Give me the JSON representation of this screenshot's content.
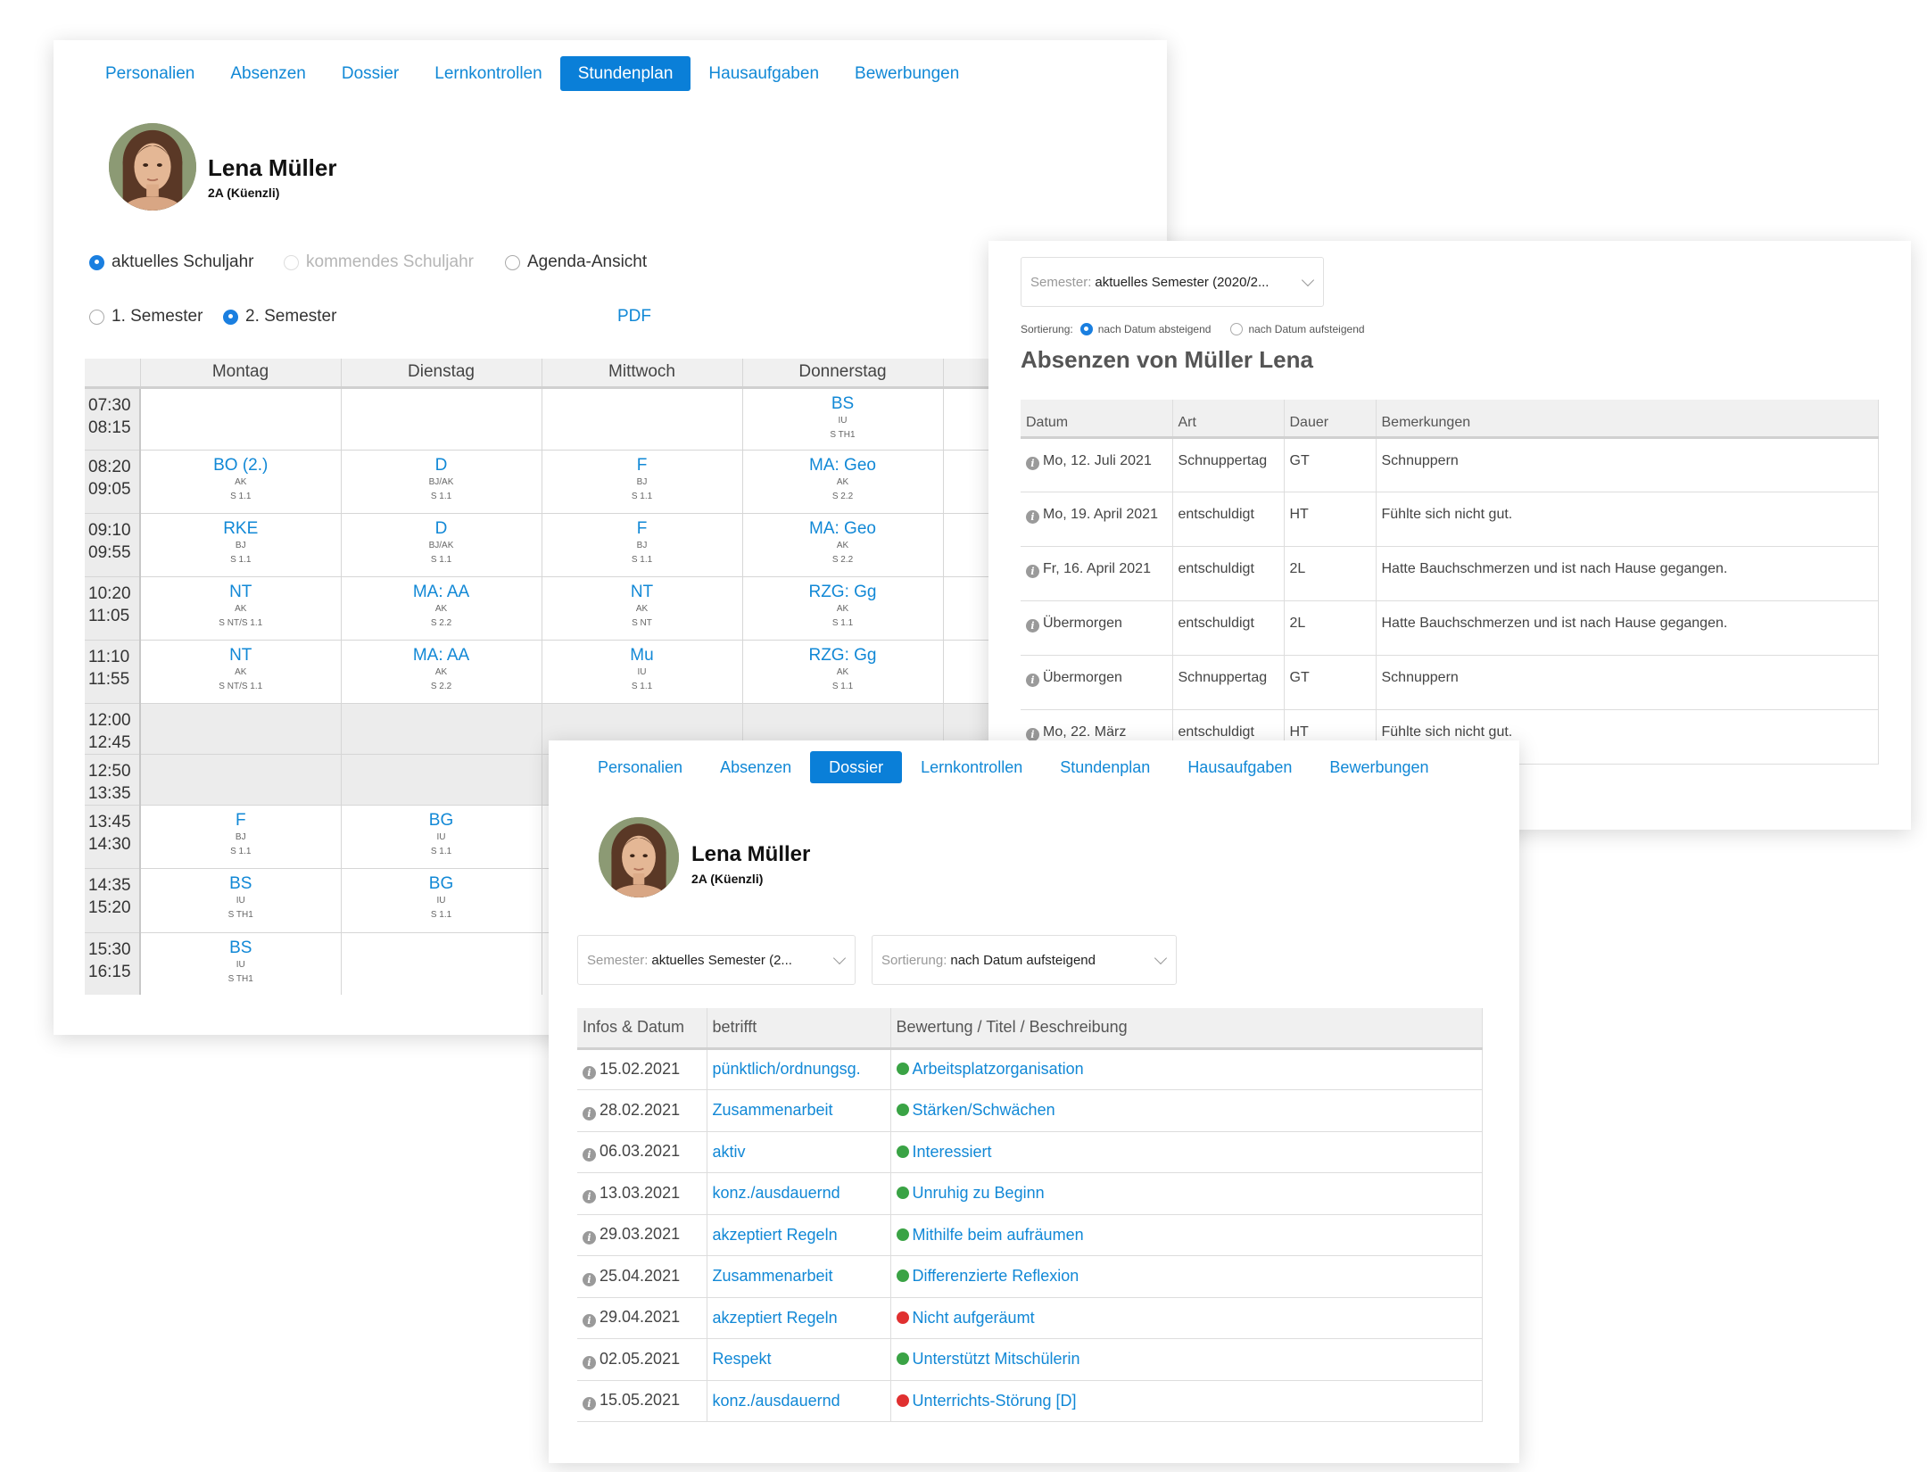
{
  "tabs": [
    "Personalien",
    "Absenzen",
    "Dossier",
    "Lernkontrollen",
    "Stundenplan",
    "Hausaufgaben",
    "Bewerbungen"
  ],
  "student": {
    "name": "Lena Müller",
    "class": "2A (Küenzli)"
  },
  "timetable_panel": {
    "active_tab": "Stundenplan",
    "view_options": [
      "aktuelles Schuljahr",
      "kommendes Schuljahr",
      "Agenda-Ansicht"
    ],
    "semester_options": [
      "1. Semester",
      "2. Semester"
    ],
    "pdf_label": "PDF",
    "days": [
      "Montag",
      "Dienstag",
      "Mittwoch",
      "Donnerstag"
    ],
    "slots": [
      {
        "start": "07:30",
        "end": "08:15",
        "cells": [
          null,
          null,
          null,
          {
            "s": "BS",
            "t": "IU",
            "r": "S TH1"
          }
        ]
      },
      {
        "start": "08:20",
        "end": "09:05",
        "cells": [
          {
            "s": "BO (2.)",
            "t": "AK",
            "r": "S 1.1"
          },
          {
            "s": "D",
            "t": "BJ/AK",
            "r": "S 1.1"
          },
          {
            "s": "F",
            "t": "BJ",
            "r": "S 1.1"
          },
          {
            "s": "MA: Geo",
            "t": "AK",
            "r": "S 2.2"
          }
        ]
      },
      {
        "start": "09:10",
        "end": "09:55",
        "cells": [
          {
            "s": "RKE",
            "t": "BJ",
            "r": "S 1.1"
          },
          {
            "s": "D",
            "t": "BJ/AK",
            "r": "S 1.1"
          },
          {
            "s": "F",
            "t": "BJ",
            "r": "S 1.1"
          },
          {
            "s": "MA: Geo",
            "t": "AK",
            "r": "S 2.2"
          }
        ]
      },
      {
        "start": "10:20",
        "end": "11:05",
        "cells": [
          {
            "s": "NT",
            "t": "AK",
            "r": "S NT/S 1.1"
          },
          {
            "s": "MA: AA",
            "t": "AK",
            "r": "S 2.2"
          },
          {
            "s": "NT",
            "t": "AK",
            "r": "S NT"
          },
          {
            "s": "RZG: Gg",
            "t": "AK",
            "r": "S 1.1"
          }
        ]
      },
      {
        "start": "11:10",
        "end": "11:55",
        "cells": [
          {
            "s": "NT",
            "t": "AK",
            "r": "S NT/S 1.1"
          },
          {
            "s": "MA: AA",
            "t": "AK",
            "r": "S 2.2"
          },
          {
            "s": "Mu",
            "t": "IU",
            "r": "S 1.1"
          },
          {
            "s": "RZG: Gg",
            "t": "AK",
            "r": "S 1.1"
          }
        ]
      },
      {
        "start": "12:00",
        "end": "12:45",
        "brk": true,
        "cells": [
          null,
          null,
          null,
          null
        ]
      },
      {
        "start": "12:50",
        "end": "13:35",
        "brk": true,
        "cells": [
          null,
          null,
          null,
          null
        ]
      },
      {
        "start": "13:45",
        "end": "14:30",
        "cells": [
          {
            "s": "F",
            "t": "BJ",
            "r": "S 1.1"
          },
          {
            "s": "BG",
            "t": "IU",
            "r": "S 1.1"
          },
          null,
          null
        ]
      },
      {
        "start": "14:35",
        "end": "15:20",
        "cells": [
          {
            "s": "BS",
            "t": "IU",
            "r": "S TH1"
          },
          {
            "s": "BG",
            "t": "IU",
            "r": "S 1.1"
          },
          null,
          null
        ]
      },
      {
        "start": "15:30",
        "end": "16:15",
        "cells": [
          {
            "s": "BS",
            "t": "IU",
            "r": "S TH1"
          },
          null,
          null,
          null
        ]
      }
    ]
  },
  "absences_panel": {
    "semester_label": "Semester:",
    "semester_value": "aktuelles Semester (2020/2...",
    "sort_label": "Sortierung:",
    "sort_options": [
      "nach Datum absteigend",
      "nach Datum aufsteigend"
    ],
    "title": "Absenzen von Müller Lena",
    "headers": [
      "Datum",
      "Art",
      "Dauer",
      "Bemerkungen"
    ],
    "rows": [
      [
        "Mo, 12. Juli 2021",
        "Schnuppertag",
        "GT",
        "Schnuppern"
      ],
      [
        "Mo, 19. April 2021",
        "entschuldigt",
        "HT",
        "Fühlte sich nicht gut."
      ],
      [
        "Fr, 16. April 2021",
        "entschuldigt",
        "2L",
        "Hatte Bauchschmerzen und ist nach Hause gegangen."
      ],
      [
        "Übermorgen",
        "entschuldigt",
        "2L",
        "Hatte Bauchschmerzen und ist nach Hause gegangen."
      ],
      [
        "Übermorgen",
        "Schnuppertag",
        "GT",
        "Schnuppern"
      ],
      [
        "Mo, 22. März",
        "entschuldigt",
        "HT",
        "Fühlte sich nicht gut."
      ]
    ]
  },
  "dossier_panel": {
    "active_tab": "Dossier",
    "semester_label": "Semester:",
    "semester_value": "aktuelles Semester (2...",
    "sort_label": "Sortierung:",
    "sort_value": "nach Datum aufsteigend",
    "headers": [
      "Infos & Datum",
      "betrifft",
      "Bewertung / Titel / Beschreibung"
    ],
    "rows": [
      {
        "date": "15.02.2021",
        "topic": "pünktlich/ordnungsg.",
        "rating": "good",
        "text": "Arbeitsplatzorganisation"
      },
      {
        "date": "28.02.2021",
        "topic": "Zusammenarbeit",
        "rating": "good",
        "text": "Stärken/Schwächen"
      },
      {
        "date": "06.03.2021",
        "topic": "aktiv",
        "rating": "good",
        "text": "Interessiert"
      },
      {
        "date": "13.03.2021",
        "topic": "konz./ausdauernd",
        "rating": "good",
        "text": "Unruhig zu Beginn"
      },
      {
        "date": "29.03.2021",
        "topic": "akzeptiert Regeln",
        "rating": "good",
        "text": "Mithilfe beim aufräumen"
      },
      {
        "date": "25.04.2021",
        "topic": "Zusammenarbeit",
        "rating": "good",
        "text": "Differenzierte Reflexion"
      },
      {
        "date": "29.04.2021",
        "topic": "akzeptiert Regeln",
        "rating": "bad",
        "text": "Nicht aufgeräumt"
      },
      {
        "date": "02.05.2021",
        "topic": "Respekt",
        "rating": "good",
        "text": "Unterstützt Mitschülerin"
      },
      {
        "date": "15.05.2021",
        "topic": "konz./ausdauernd",
        "rating": "bad",
        "text": "Unterrichts-Störung [D]"
      }
    ]
  },
  "colors": {
    "accent": "#0a7fd8",
    "link": "#1188d6",
    "good": "#3aa345",
    "bad": "#e03030"
  },
  "icons": {
    "info": "info-icon",
    "dropdown": "chevron-down-icon"
  }
}
